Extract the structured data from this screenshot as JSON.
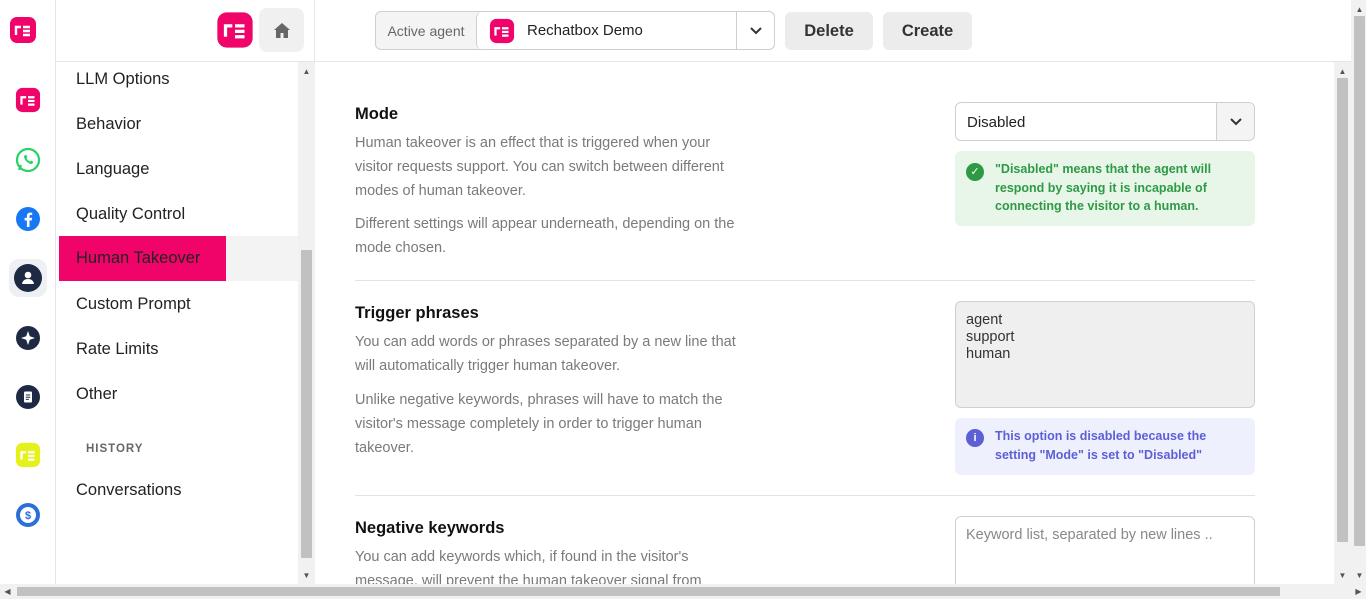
{
  "topbar": {
    "active_agent_label": "Active agent",
    "agent_name": "Rechatbox Demo",
    "delete_label": "Delete",
    "create_label": "Create"
  },
  "rail": {
    "items": [
      "rechatbox-icon",
      "whatsapp-icon",
      "facebook-icon",
      "user-icon",
      "sparkle-icon",
      "document-icon",
      "rechatbox-yellow-icon",
      "dollar-icon"
    ],
    "active": "user-icon"
  },
  "nav": {
    "items": [
      {
        "label": "LLM Options"
      },
      {
        "label": "Behavior"
      },
      {
        "label": "Language"
      },
      {
        "label": "Quality Control"
      },
      {
        "label": "Human Takeover"
      },
      {
        "label": "Custom Prompt"
      },
      {
        "label": "Rate Limits"
      },
      {
        "label": "Other"
      }
    ],
    "active": "Human Takeover",
    "history_heading": "HISTORY",
    "history_items": [
      {
        "label": "Conversations"
      }
    ]
  },
  "main": {
    "mode": {
      "title": "Mode",
      "desc1": "Human takeover is an effect that is triggered when your visitor requests support. You can switch between different modes of human takeover.",
      "desc2": "Different settings will appear underneath, depending on the mode chosen.",
      "value": "Disabled",
      "alert": "\"Disabled\" means that the agent will respond by saying it is incapable of connecting the visitor to a human."
    },
    "trigger": {
      "title": "Trigger phrases",
      "desc1": "You can add words or phrases separated by a new line that will automatically trigger human takeover.",
      "desc2": "Unlike negative keywords, phrases will have to match the visitor's message completely in order to trigger human takeover.",
      "phrases": [
        "agent",
        "support",
        "human"
      ],
      "alert": "This option is disabled because the setting \"Mode\" is set to \"Disabled\""
    },
    "negative": {
      "title": "Negative keywords",
      "desc1": "You can add keywords which, if found in the visitor's message, will prevent the human takeover signal from",
      "placeholder": "Keyword list, separated by new lines .."
    }
  },
  "colors": {
    "brand": "#f0046a",
    "success_bg": "#e8f6ea",
    "success_text": "#2e9a44",
    "info_bg": "#eff0fd",
    "info_text": "#5c5fd6"
  }
}
